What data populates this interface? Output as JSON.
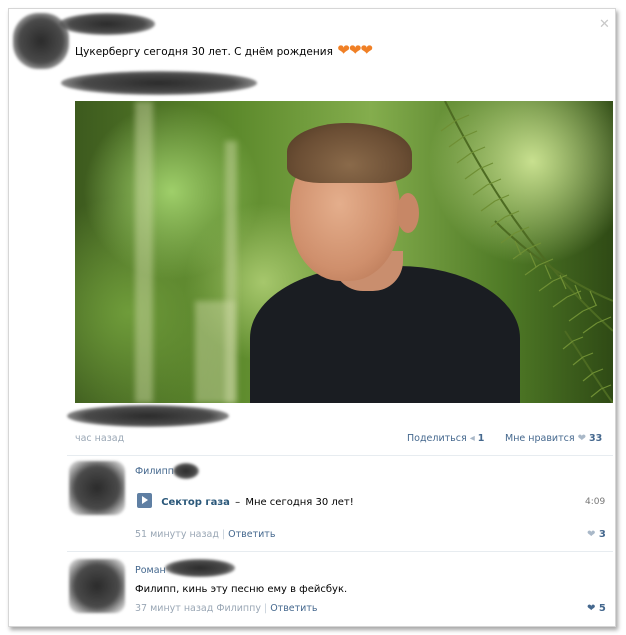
{
  "post": {
    "text": "Цукербергу сегодня 30 лет. С днём рождения",
    "hearts": "❤❤❤",
    "close_glyph": "✕",
    "time": "час назад",
    "share_label": "Поделиться",
    "share_count": "1",
    "like_label": "Мне нравится",
    "like_count": "33"
  },
  "comments": [
    {
      "author": "Филипп",
      "audio": {
        "artist": "Сектор газа",
        "dash": "–",
        "title": "Мне сегодня 30 лет!",
        "duration": "4:09"
      },
      "time": "51 минуту назад",
      "reply_label": "Ответить",
      "likes": "3"
    },
    {
      "author": "Роман",
      "text": "Филипп, кинь эту песню ему в фейсбук.",
      "time": "37 минут назад Филиппу",
      "reply_label": "Ответить",
      "likes": "5"
    }
  ],
  "colors": {
    "link": "#45688e",
    "meta": "#9aa7b5",
    "heart_accent": "#f08026"
  },
  "icons": {
    "close": "close-icon",
    "share": "megaphone-icon",
    "like": "heart-icon",
    "play": "play-icon"
  }
}
